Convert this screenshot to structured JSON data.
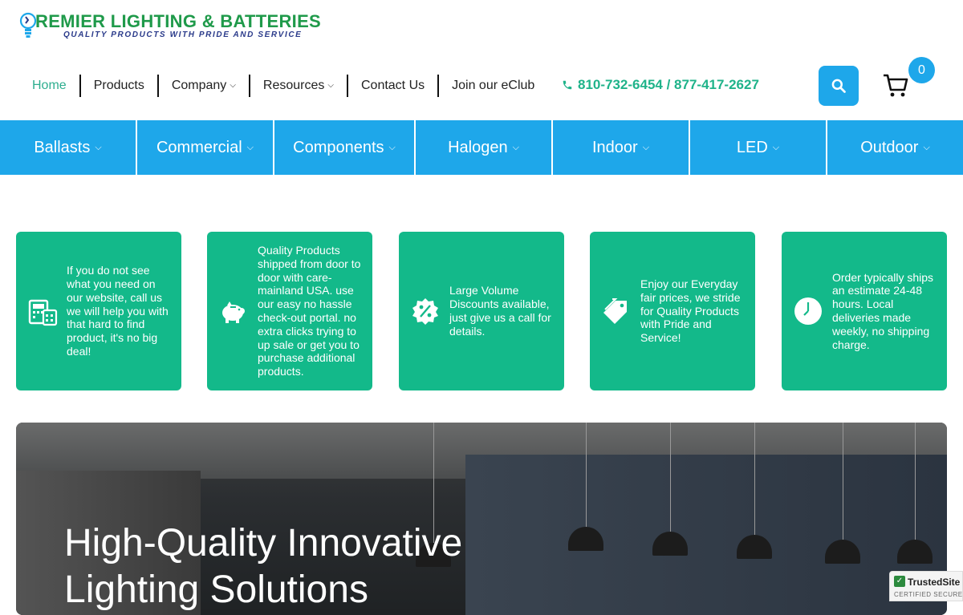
{
  "brand": {
    "name": "REMIER LIGHTING & BATTERIES",
    "tagline": "QUALITY PRODUCTS WITH PRIDE AND SERVICE",
    "color_green": "#1f9a4a",
    "color_navy": "#2a3a8a"
  },
  "topnav": {
    "items": [
      {
        "label": "Home",
        "dropdown": false,
        "active": true
      },
      {
        "label": "Products",
        "dropdown": false
      },
      {
        "label": "Company",
        "dropdown": true
      },
      {
        "label": "Resources",
        "dropdown": true
      },
      {
        "label": "Contact Us",
        "dropdown": false
      },
      {
        "label": "Join our eClub",
        "dropdown": false
      }
    ],
    "chevron": "⌵"
  },
  "phone": {
    "text": "810-732-6454 / 877-417-2627",
    "icon": "phone-icon",
    "color": "#1fb38a"
  },
  "cart": {
    "count": "0",
    "icon": "cart-icon"
  },
  "search": {
    "icon": "search-icon"
  },
  "accent": "#1ea7ea",
  "categories": [
    {
      "label": "Ballasts"
    },
    {
      "label": "Commercial"
    },
    {
      "label": "Components"
    },
    {
      "label": "Halogen"
    },
    {
      "label": "Indoor"
    },
    {
      "label": "LED"
    },
    {
      "label": "Outdoor"
    }
  ],
  "features": [
    {
      "icon": "calculator-calendar-icon",
      "text": "If you do not see what you need on our website, call us we will help you with that hard to find product, it's no big deal!"
    },
    {
      "icon": "piggy-bank-icon",
      "text": "Quality Products shipped from door to door with care- mainland USA. use our easy no hassle check-out portal. no extra clicks trying to up sale or get you to purchase additional products."
    },
    {
      "icon": "percent-badge-icon",
      "text": "Large Volume Discounts available, just give us a call for details."
    },
    {
      "icon": "tags-icon",
      "text": "Enjoy our Everyday fair prices, we stride for Quality Products with Pride and Service!"
    },
    {
      "icon": "clock-icon",
      "text": "Order typically ships an estimate 24-48 hours. Local deliveries made weekly, no shipping charge."
    }
  ],
  "feature_color": "#13b98a",
  "hero": {
    "title_line1": "High-Quality Innovative",
    "title_line2": "Lighting Solutions"
  },
  "badge": {
    "title": "TrustedSite",
    "subtitle": "CERTIFIED SECURE"
  }
}
